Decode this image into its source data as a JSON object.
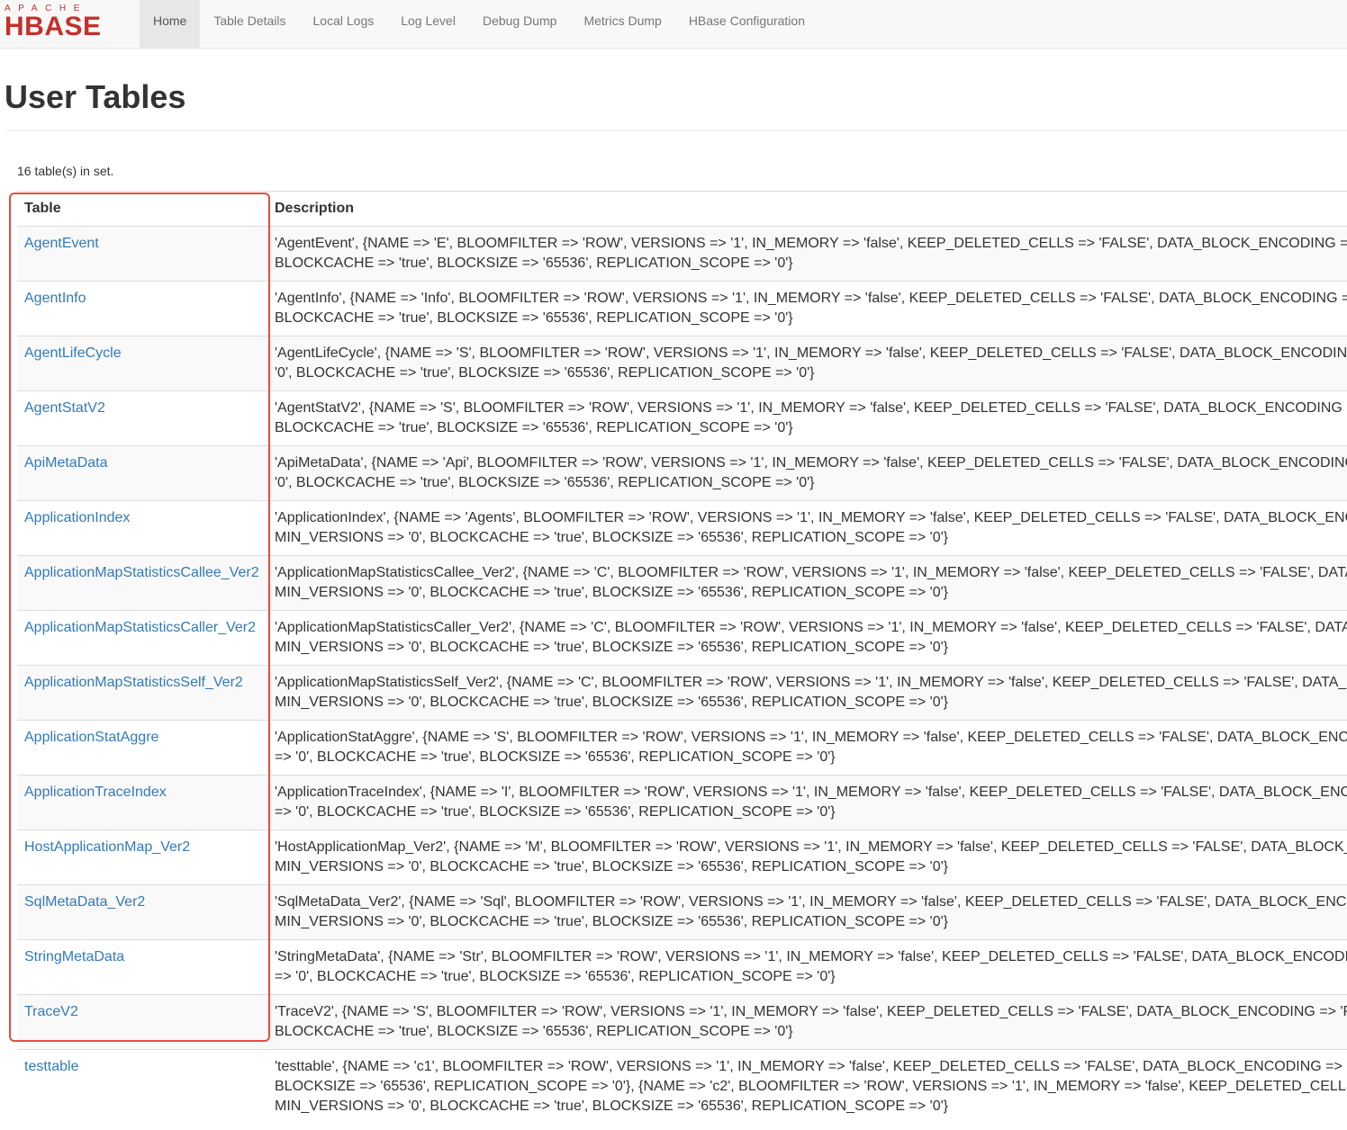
{
  "logo": {
    "apache": "APACHE",
    "hbase": "HBASE"
  },
  "nav": [
    "Home",
    "Table Details",
    "Local Logs",
    "Log Level",
    "Debug Dump",
    "Metrics Dump",
    "HBase Configuration"
  ],
  "page": {
    "title": "User Tables",
    "count": "16 table(s) in set."
  },
  "table": {
    "headers": {
      "name": "Table",
      "description": "Description"
    },
    "rows": [
      {
        "name": "AgentEvent",
        "desc1": "'AgentEvent', {NAME => 'E', BLOOMFILTER => 'ROW', VERSIONS => '1', IN_MEMORY => 'false', KEEP_DELETED_CELLS => 'FALSE', DATA_BLOCK_ENCODING =>",
        "desc2": "BLOCKCACHE => 'true', BLOCKSIZE => '65536', REPLICATION_SCOPE => '0'}"
      },
      {
        "name": "AgentInfo",
        "desc1": "'AgentInfo', {NAME => 'Info', BLOOMFILTER => 'ROW', VERSIONS => '1', IN_MEMORY => 'false', KEEP_DELETED_CELLS => 'FALSE', DATA_BLOCK_ENCODING =>",
        "desc2": "BLOCKCACHE => 'true', BLOCKSIZE => '65536', REPLICATION_SCOPE => '0'}"
      },
      {
        "name": "AgentLifeCycle",
        "desc1": "'AgentLifeCycle', {NAME => 'S', BLOOMFILTER => 'ROW', VERSIONS => '1', IN_MEMORY => 'false', KEEP_DELETED_CELLS => 'FALSE', DATA_BLOCK_ENCODING",
        "desc2": "'0', BLOCKCACHE => 'true', BLOCKSIZE => '65536', REPLICATION_SCOPE => '0'}"
      },
      {
        "name": "AgentStatV2",
        "desc1": "'AgentStatV2', {NAME => 'S', BLOOMFILTER => 'ROW', VERSIONS => '1', IN_MEMORY => 'false', KEEP_DELETED_CELLS => 'FALSE', DATA_BLOCK_ENCODING =",
        "desc2": "BLOCKCACHE => 'true', BLOCKSIZE => '65536', REPLICATION_SCOPE => '0'}"
      },
      {
        "name": "ApiMetaData",
        "desc1": "'ApiMetaData', {NAME => 'Api', BLOOMFILTER => 'ROW', VERSIONS => '1', IN_MEMORY => 'false', KEEP_DELETED_CELLS => 'FALSE', DATA_BLOCK_ENCODING",
        "desc2": "'0', BLOCKCACHE => 'true', BLOCKSIZE => '65536', REPLICATION_SCOPE => '0'}"
      },
      {
        "name": "ApplicationIndex",
        "desc1": "'ApplicationIndex', {NAME => 'Agents', BLOOMFILTER => 'ROW', VERSIONS => '1', IN_MEMORY => 'false', KEEP_DELETED_CELLS => 'FALSE', DATA_BLOCK_ENC",
        "desc2": "MIN_VERSIONS => '0', BLOCKCACHE => 'true', BLOCKSIZE => '65536', REPLICATION_SCOPE => '0'}"
      },
      {
        "name": "ApplicationMapStatisticsCallee_Ver2",
        "desc1": "'ApplicationMapStatisticsCallee_Ver2', {NAME => 'C', BLOOMFILTER => 'ROW', VERSIONS => '1', IN_MEMORY => 'false', KEEP_DELETED_CELLS => 'FALSE', DATA",
        "desc2": "MIN_VERSIONS => '0', BLOCKCACHE => 'true', BLOCKSIZE => '65536', REPLICATION_SCOPE => '0'}"
      },
      {
        "name": "ApplicationMapStatisticsCaller_Ver2",
        "desc1": "'ApplicationMapStatisticsCaller_Ver2', {NAME => 'C', BLOOMFILTER => 'ROW', VERSIONS => '1', IN_MEMORY => 'false', KEEP_DELETED_CELLS => 'FALSE', DATA",
        "desc2": "MIN_VERSIONS => '0', BLOCKCACHE => 'true', BLOCKSIZE => '65536', REPLICATION_SCOPE => '0'}"
      },
      {
        "name": "ApplicationMapStatisticsSelf_Ver2",
        "desc1": "'ApplicationMapStatisticsSelf_Ver2', {NAME => 'C', BLOOMFILTER => 'ROW', VERSIONS => '1', IN_MEMORY => 'false', KEEP_DELETED_CELLS => 'FALSE', DATA_B",
        "desc2": "MIN_VERSIONS => '0', BLOCKCACHE => 'true', BLOCKSIZE => '65536', REPLICATION_SCOPE => '0'}"
      },
      {
        "name": "ApplicationStatAggre",
        "desc1": "'ApplicationStatAggre', {NAME => 'S', BLOOMFILTER => 'ROW', VERSIONS => '1', IN_MEMORY => 'false', KEEP_DELETED_CELLS => 'FALSE', DATA_BLOCK_ENCO",
        "desc2": "=> '0', BLOCKCACHE => 'true', BLOCKSIZE => '65536', REPLICATION_SCOPE => '0'}"
      },
      {
        "name": "ApplicationTraceIndex",
        "desc1": "'ApplicationTraceIndex', {NAME => 'I', BLOOMFILTER => 'ROW', VERSIONS => '1', IN_MEMORY => 'false', KEEP_DELETED_CELLS => 'FALSE', DATA_BLOCK_ENCO",
        "desc2": "=> '0', BLOCKCACHE => 'true', BLOCKSIZE => '65536', REPLICATION_SCOPE => '0'}"
      },
      {
        "name": "HostApplicationMap_Ver2",
        "desc1": "'HostApplicationMap_Ver2', {NAME => 'M', BLOOMFILTER => 'ROW', VERSIONS => '1', IN_MEMORY => 'false', KEEP_DELETED_CELLS => 'FALSE', DATA_BLOCK_",
        "desc2": "MIN_VERSIONS => '0', BLOCKCACHE => 'true', BLOCKSIZE => '65536', REPLICATION_SCOPE => '0'}"
      },
      {
        "name": "SqlMetaData_Ver2",
        "desc1": "'SqlMetaData_Ver2', {NAME => 'Sql', BLOOMFILTER => 'ROW', VERSIONS => '1', IN_MEMORY => 'false', KEEP_DELETED_CELLS => 'FALSE', DATA_BLOCK_ENCO",
        "desc2": "MIN_VERSIONS => '0', BLOCKCACHE => 'true', BLOCKSIZE => '65536', REPLICATION_SCOPE => '0'}"
      },
      {
        "name": "StringMetaData",
        "desc1": "'StringMetaData', {NAME => 'Str', BLOOMFILTER => 'ROW', VERSIONS => '1', IN_MEMORY => 'false', KEEP_DELETED_CELLS => 'FALSE', DATA_BLOCK_ENCODIN",
        "desc2": "=> '0', BLOCKCACHE => 'true', BLOCKSIZE => '65536', REPLICATION_SCOPE => '0'}"
      },
      {
        "name": "TraceV2",
        "desc1": "'TraceV2', {NAME => 'S', BLOOMFILTER => 'ROW', VERSIONS => '1', IN_MEMORY => 'false', KEEP_DELETED_CELLS => 'FALSE', DATA_BLOCK_ENCODING => 'PI",
        "desc2": "BLOCKCACHE => 'true', BLOCKSIZE => '65536', REPLICATION_SCOPE => '0'}"
      },
      {
        "name": "testtable",
        "desc1": "'testtable', {NAME => 'c1', BLOOMFILTER => 'ROW', VERSIONS => '1', IN_MEMORY => 'false', KEEP_DELETED_CELLS => 'FALSE', DATA_BLOCK_ENCODING => 'I",
        "desc2": "BLOCKSIZE => '65536', REPLICATION_SCOPE => '0'}, {NAME => 'c2', BLOOMFILTER => 'ROW', VERSIONS => '1', IN_MEMORY => 'false', KEEP_DELETED_CELLS",
        "desc3": "MIN_VERSIONS => '0', BLOCKCACHE => 'true', BLOCKSIZE => '65536', REPLICATION_SCOPE => '0'}"
      }
    ]
  },
  "colors": {
    "link": "#337ab7",
    "logo": "#c4302b",
    "highlight": "#e74c3c"
  }
}
